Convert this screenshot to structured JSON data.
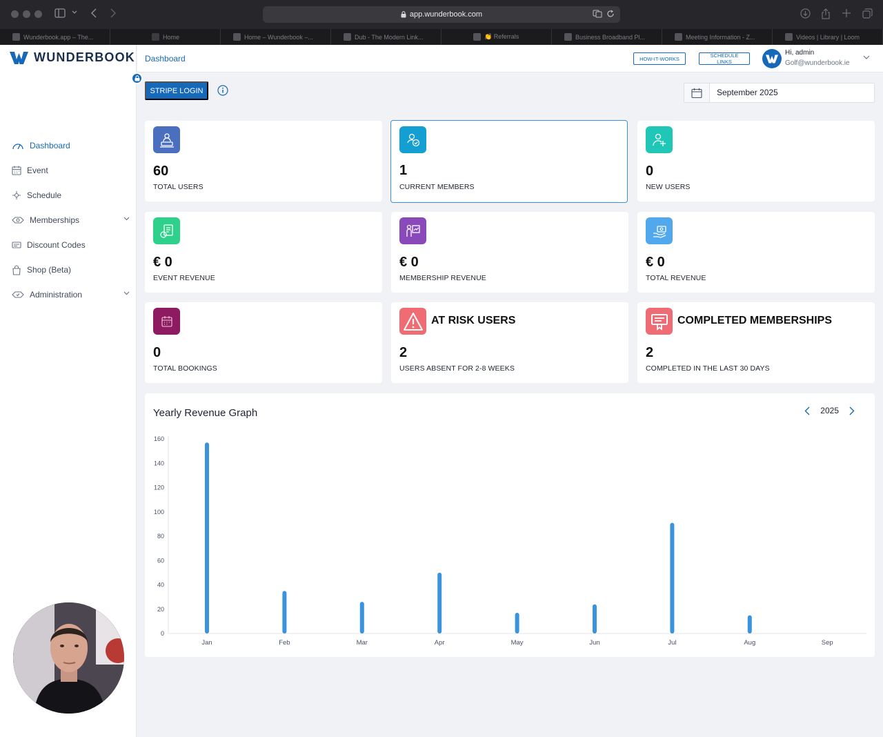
{
  "browser": {
    "url": "app.wunderbook.com",
    "tabs": [
      "Wunderbook.app – The...",
      "Home",
      "Home – Wunderbook –...",
      "Dub - The Modern Link...",
      "👏 Referrals",
      "Business Broadband Pl...",
      "Meeting Information - Z...",
      "Videos | Library | Loom"
    ]
  },
  "brand": {
    "name": "WUNDERBOOK",
    "color": "#1669b9"
  },
  "sidebar": {
    "items": [
      {
        "label": "Dashboard",
        "icon": "speedometer-icon"
      },
      {
        "label": "Event",
        "icon": "calendar-icon"
      },
      {
        "label": "Schedule",
        "icon": "schedule-icon"
      },
      {
        "label": "Memberships",
        "icon": "memberships-icon"
      },
      {
        "label": "Discount Codes",
        "icon": "ticket-icon"
      },
      {
        "label": "Shop (Beta)",
        "icon": "bag-icon"
      },
      {
        "label": "Administration",
        "icon": "admin-icon"
      }
    ]
  },
  "header": {
    "breadcrumb": "Dashboard",
    "how_it_works": "HOW-IT-WORKS",
    "schedule_links": "SCHEDULE LINKS",
    "greeting": "Hi, admin",
    "email": "Golf@wunderbook.ie"
  },
  "toolbar": {
    "stripe_login": "STRIPE LOGIN",
    "date": "September 2025"
  },
  "cards": [
    {
      "value": "60",
      "label": "TOTAL USERS",
      "icon": "user-monitor-icon",
      "color": "#4a6fbf"
    },
    {
      "value": "1",
      "label": "CURRENT MEMBERS",
      "icon": "member-check-icon",
      "color": "#139fd2"
    },
    {
      "value": "0",
      "label": "NEW USERS",
      "icon": "user-plus-icon",
      "color": "#20c7b7"
    },
    {
      "value": "€ 0",
      "label": "EVENT REVENUE",
      "icon": "event-revenue-icon",
      "color": "#2ed18c"
    },
    {
      "value": "€ 0",
      "label": "MEMBERSHIP REVENUE",
      "icon": "presenter-chart-icon",
      "color": "#8a49b8"
    },
    {
      "value": "€ 0",
      "label": "TOTAL REVENUE",
      "icon": "cash-hand-icon",
      "color": "#52a8ec"
    },
    {
      "value": "0",
      "label": "TOTAL BOOKINGS",
      "icon": "booking-calendar-icon",
      "color": "#8e1a62"
    },
    {
      "title": "AT RISK USERS",
      "value": "2",
      "label": "USERS ABSENT FOR 2-8 WEEKS",
      "icon": "warning-icon",
      "color": "#ef6c74"
    },
    {
      "title": "COMPLETED MEMBERSHIPS",
      "value": "2",
      "label": "COMPLETED IN THE LAST 30 DAYS",
      "icon": "certificate-icon",
      "color": "#ef6c74"
    }
  ],
  "revenue_graph": {
    "title": "Yearly Revenue Graph",
    "year": "2025"
  },
  "chart_data": {
    "type": "bar",
    "categories": [
      "Jan",
      "Feb",
      "Mar",
      "Apr",
      "May",
      "Jun",
      "Jul",
      "Aug",
      "Sep"
    ],
    "values": [
      157,
      35,
      26,
      50,
      17,
      24,
      91,
      15,
      0
    ],
    "ylim": [
      0,
      160
    ],
    "yticks": [
      0,
      20,
      40,
      60,
      80,
      100,
      120,
      140,
      160
    ],
    "bar_color": "#3a93dd"
  }
}
